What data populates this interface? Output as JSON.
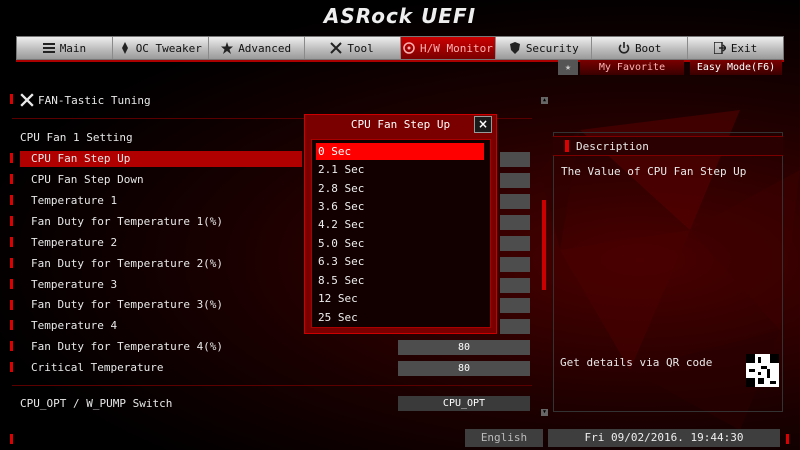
{
  "header": {
    "logo": "ASRock UEFI"
  },
  "nav": {
    "items": [
      {
        "label": "Main",
        "icon": "list-icon"
      },
      {
        "label": "OC Tweaker",
        "icon": "rocket-icon"
      },
      {
        "label": "Advanced",
        "icon": "star-icon"
      },
      {
        "label": "Tool",
        "icon": "tools-icon"
      },
      {
        "label": "H/W Monitor",
        "icon": "monitor-icon",
        "active": true
      },
      {
        "label": "Security",
        "icon": "shield-icon"
      },
      {
        "label": "Boot",
        "icon": "power-icon"
      },
      {
        "label": "Exit",
        "icon": "exit-icon"
      }
    ],
    "my_favorite": "My Favorite",
    "easy_mode": "Easy Mode(F6)"
  },
  "main": {
    "section_title": "FAN-Tastic Tuning",
    "group_title": "CPU Fan 1 Setting",
    "settings": [
      {
        "label": "CPU Fan Step Up",
        "value": ""
      },
      {
        "label": "CPU Fan Step Down",
        "value": ""
      },
      {
        "label": "Temperature 1",
        "value": ""
      },
      {
        "label": "Fan Duty for Temperature 1(%)",
        "value": ""
      },
      {
        "label": "Temperature 2",
        "value": ""
      },
      {
        "label": "Fan Duty for Temperature 2(%)",
        "value": ""
      },
      {
        "label": "Temperature 3",
        "value": ""
      },
      {
        "label": "Fan Duty for Temperature 3(%)",
        "value": ""
      },
      {
        "label": "Temperature 4",
        "value": ""
      },
      {
        "label": "Fan Duty for Temperature 4(%)",
        "value": "80"
      },
      {
        "label": "Critical Temperature",
        "value": "80"
      }
    ],
    "pump_switch": {
      "label": "CPU_OPT / W_PUMP Switch",
      "value": "CPU_OPT"
    }
  },
  "popup": {
    "title": "CPU Fan Step Up",
    "close": "×",
    "options": [
      "0 Sec",
      "2.1 Sec",
      "2.8 Sec",
      "3.6 Sec",
      "4.2 Sec",
      "5.0 Sec",
      "6.3 Sec",
      "8.5 Sec",
      "12 Sec",
      "25 Sec"
    ],
    "selected_index": 0
  },
  "description": {
    "title": "Description",
    "text": "The Value of CPU Fan Step Up",
    "qr_text": "Get details via QR code"
  },
  "status": {
    "language": "English",
    "datetime": "Fri 09/02/2016. 19:44:30"
  },
  "colors": {
    "accent": "#cc0000",
    "highlight": "#ff0000",
    "panel": "#4d4d4d"
  }
}
